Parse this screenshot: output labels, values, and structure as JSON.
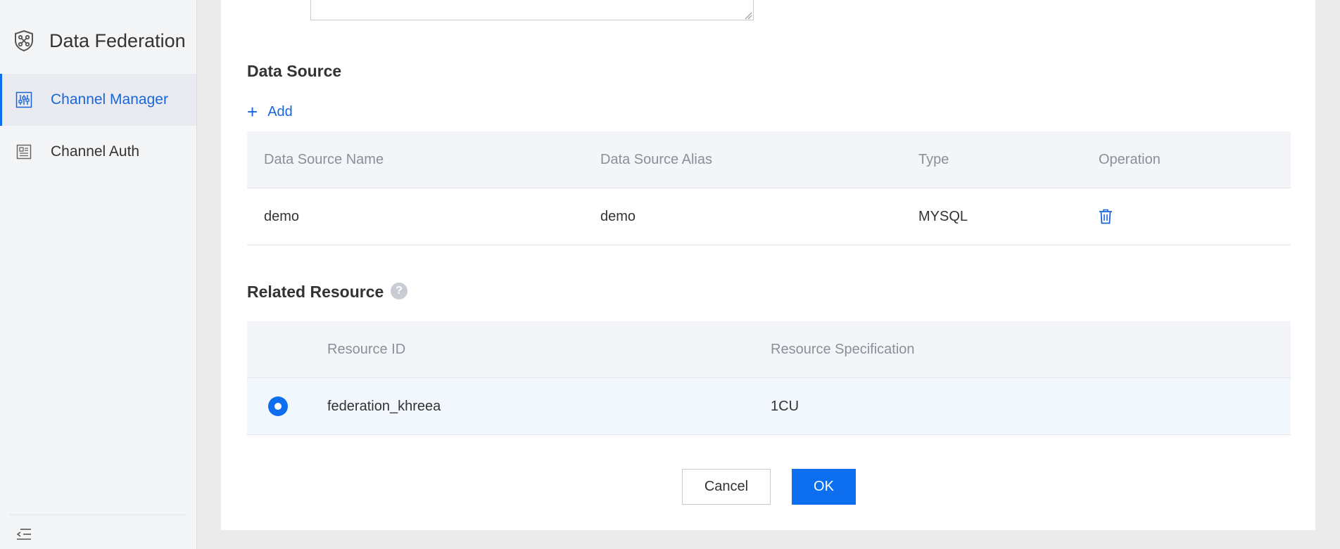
{
  "sidebar": {
    "title": "Data Federation",
    "items": [
      {
        "label": "Channel Manager",
        "icon": "sliders-icon",
        "active": true
      },
      {
        "label": "Channel Auth",
        "icon": "document-icon",
        "active": false
      }
    ],
    "collapse_icon": "collapse-menu-icon"
  },
  "data_source": {
    "title": "Data Source",
    "add_label": "Add",
    "columns": [
      "Data Source Name",
      "Data Source Alias",
      "Type",
      "Operation"
    ],
    "rows": [
      {
        "name": "demo",
        "alias": "demo",
        "type": "MYSQL",
        "operation_icon": "trash-icon"
      }
    ]
  },
  "related_resource": {
    "title": "Related Resource",
    "help_glyph": "?",
    "columns": [
      "",
      "Resource ID",
      "Resource Specification"
    ],
    "rows": [
      {
        "selected": true,
        "resource_id": "federation_khreea",
        "specification": "1CU"
      }
    ]
  },
  "actions": {
    "cancel_label": "Cancel",
    "ok_label": "OK"
  },
  "colors": {
    "accent": "#0d6ef0",
    "link": "#1a66d9",
    "sidebar_bg": "#f4f5f7",
    "page_bg": "#ebebeb"
  }
}
